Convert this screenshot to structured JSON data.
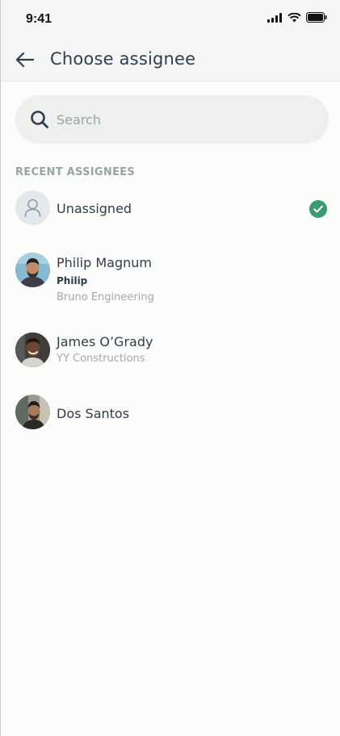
{
  "status_bar": {
    "time": "9:41"
  },
  "header": {
    "title": "Choose assignee",
    "back_icon": "arrow-left-icon"
  },
  "search": {
    "placeholder": "Search",
    "value": "",
    "icon": "search-icon"
  },
  "section": {
    "label": "RECENT ASSIGNEES"
  },
  "assignees": [
    {
      "name": "Unassigned",
      "selected": true,
      "avatar": "user-placeholder-icon"
    },
    {
      "name": "Philip Magnum",
      "nickname": "Philip",
      "company": "Bruno Engineering",
      "selected": false
    },
    {
      "name": "James O’Grady",
      "company": "YY Constructions",
      "selected": false
    },
    {
      "name": "Dos Santos",
      "selected": false
    }
  ],
  "colors": {
    "accent_check": "#3a9b73",
    "text_primary": "#2f3d4c",
    "text_secondary": "#a2aaa8",
    "section_label": "#97a5a0",
    "search_bg": "#edf0ec"
  }
}
